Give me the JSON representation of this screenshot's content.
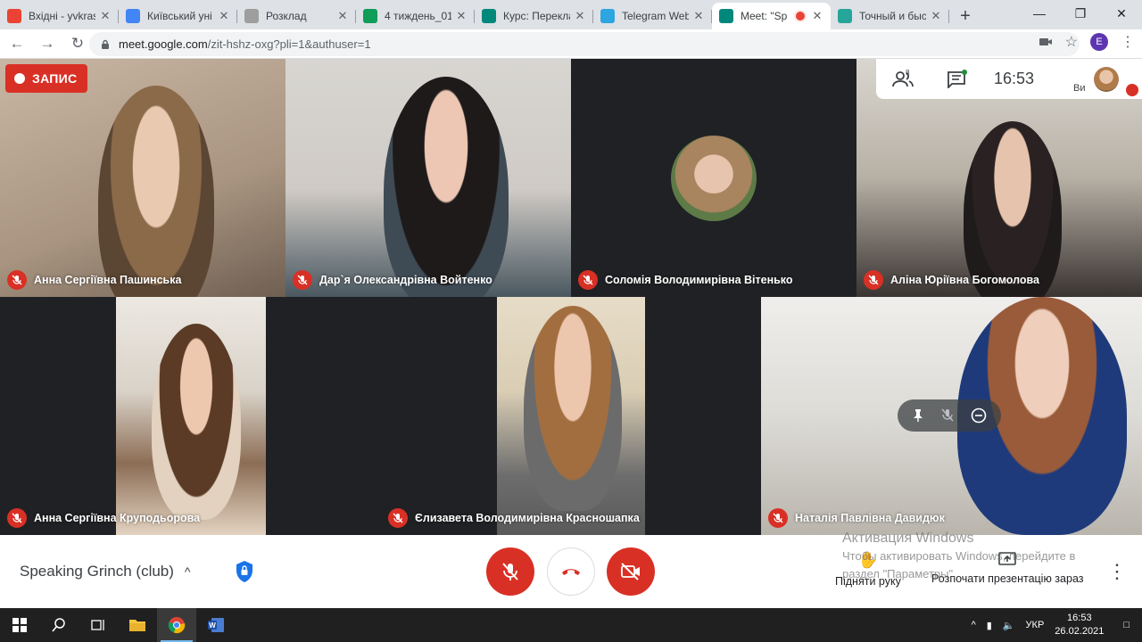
{
  "browser": {
    "tabs": [
      {
        "title": "Вхідні - yvkras",
        "icon": "gmail-icon",
        "color": "#ea4335"
      },
      {
        "title": "Київський уні",
        "icon": "calendar-icon",
        "color": "#4285f4"
      },
      {
        "title": "Розклад",
        "icon": "document-icon",
        "color": "#9e9e9e"
      },
      {
        "title": "4 тиждень_01",
        "icon": "sheets-icon",
        "color": "#0f9d58"
      },
      {
        "title": "Курс: Перекла",
        "icon": "course-icon",
        "color": "#00897b"
      },
      {
        "title": "Telegram Web",
        "icon": "telegram-icon",
        "color": "#2ca5e0"
      },
      {
        "title": "Meet: \"Sp",
        "icon": "meet-icon",
        "color": "#00897b",
        "active": true
      },
      {
        "title": "Точный и быс",
        "icon": "translate-icon",
        "color": "#26a69a"
      }
    ],
    "new_tab": "+",
    "url_host": "meet.google.com",
    "url_path": "/zit-hshz-oxg?pli=1&authuser=1",
    "profile_initial": "E"
  },
  "meet": {
    "recording_label": "ЗАПИС",
    "clock": "16:53",
    "participant_count": "8",
    "self_caption": "Ви",
    "participants": [
      {
        "name": "Анна Сергіївна Пашинська",
        "muted": true
      },
      {
        "name": "Дар`я Олександрівна Войтенко",
        "muted": true
      },
      {
        "name": "Соломія Володимирівна Вітенько",
        "muted": true
      },
      {
        "name": "Аліна Юріївна Богомолова",
        "muted": true
      },
      {
        "name": "Анна Сергіївна Круподьорова",
        "muted": true
      },
      {
        "name": "Єлизавета Володимирівна Красношапка",
        "muted": true
      },
      {
        "name": "Наталія Павлівна Давидюк",
        "muted": true
      }
    ],
    "meeting_name": "Speaking Grinch (club)",
    "actions": {
      "raise_hand": "Підняти руку",
      "present": "Розпочати презентацію зараз"
    }
  },
  "windows": {
    "activation_title": "Активация Windows",
    "activation_line1": "Чтобы активировать Windows, перейдите в",
    "activation_line2": "раздел \"Параметры\".",
    "lang": "УКР",
    "time": "16:53",
    "date": "26.02.2021"
  }
}
